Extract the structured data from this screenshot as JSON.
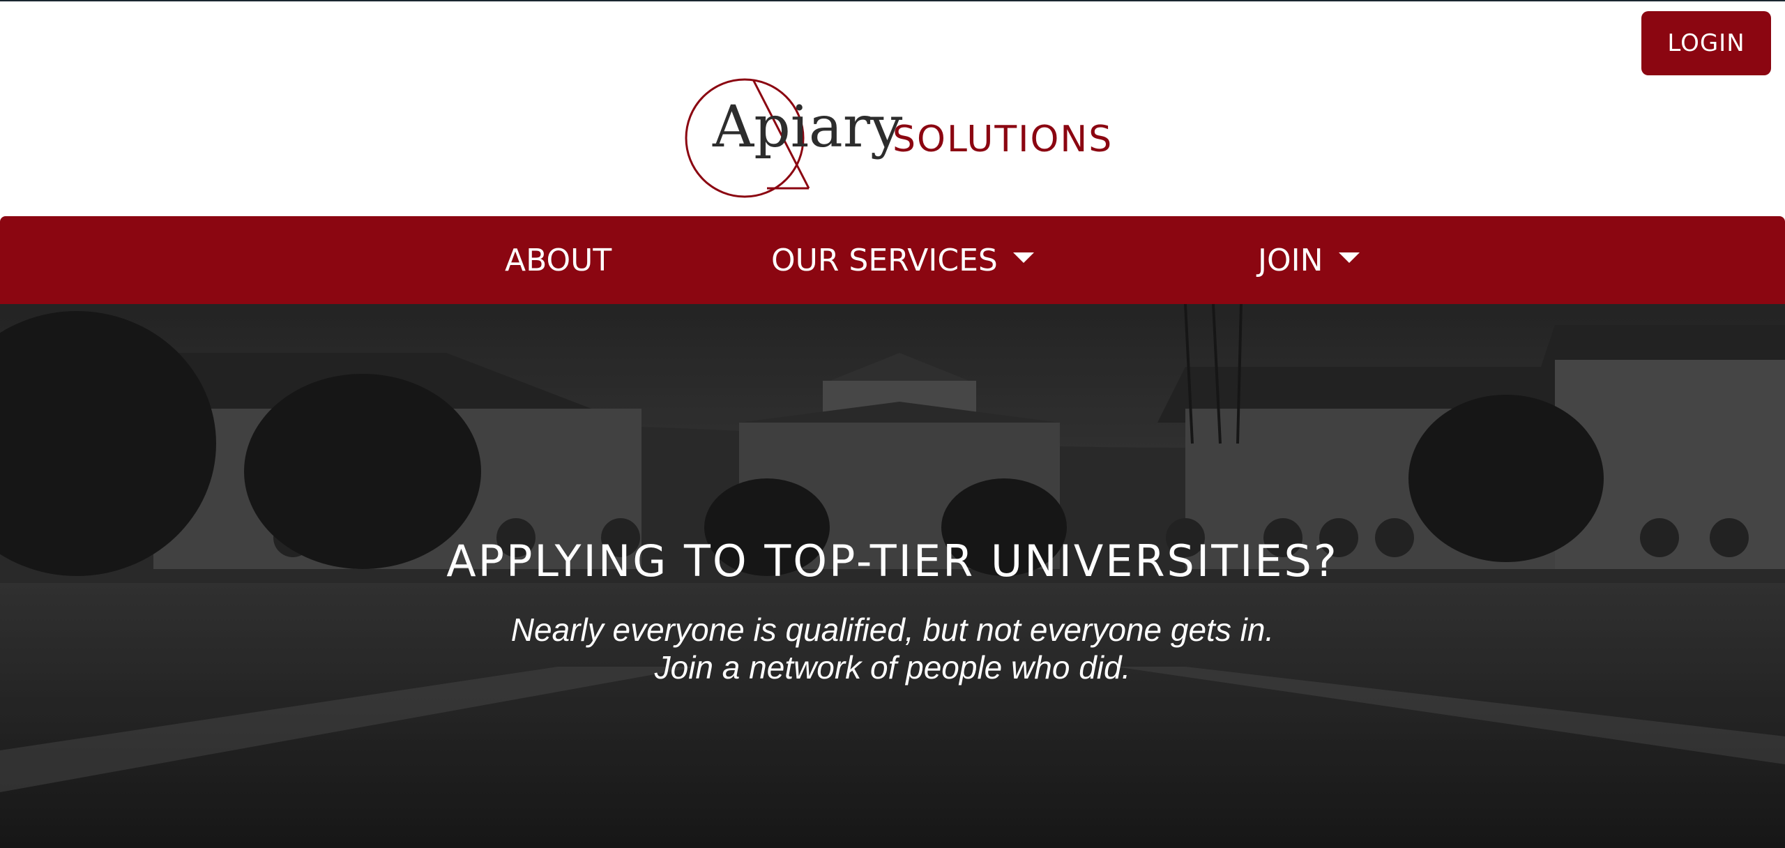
{
  "header": {
    "login_label": "LOGIN",
    "logo": {
      "wordmark": "Apiary",
      "subtitle": "SOLUTIONS"
    }
  },
  "nav": {
    "items": [
      {
        "label": "ABOUT",
        "has_dropdown": false
      },
      {
        "label": "OUR SERVICES",
        "has_dropdown": true
      },
      {
        "label": "JOIN",
        "has_dropdown": true
      }
    ]
  },
  "hero": {
    "title": "APPLYING TO TOP-TIER UNIVERSITIES?",
    "subtitle_line1": "Nearly everyone is qualified, but not everyone gets in.",
    "subtitle_line2": "Join a network of people who did."
  },
  "colors": {
    "brand": "#8b0611",
    "text_dark": "#2d2d2d",
    "white": "#ffffff"
  }
}
